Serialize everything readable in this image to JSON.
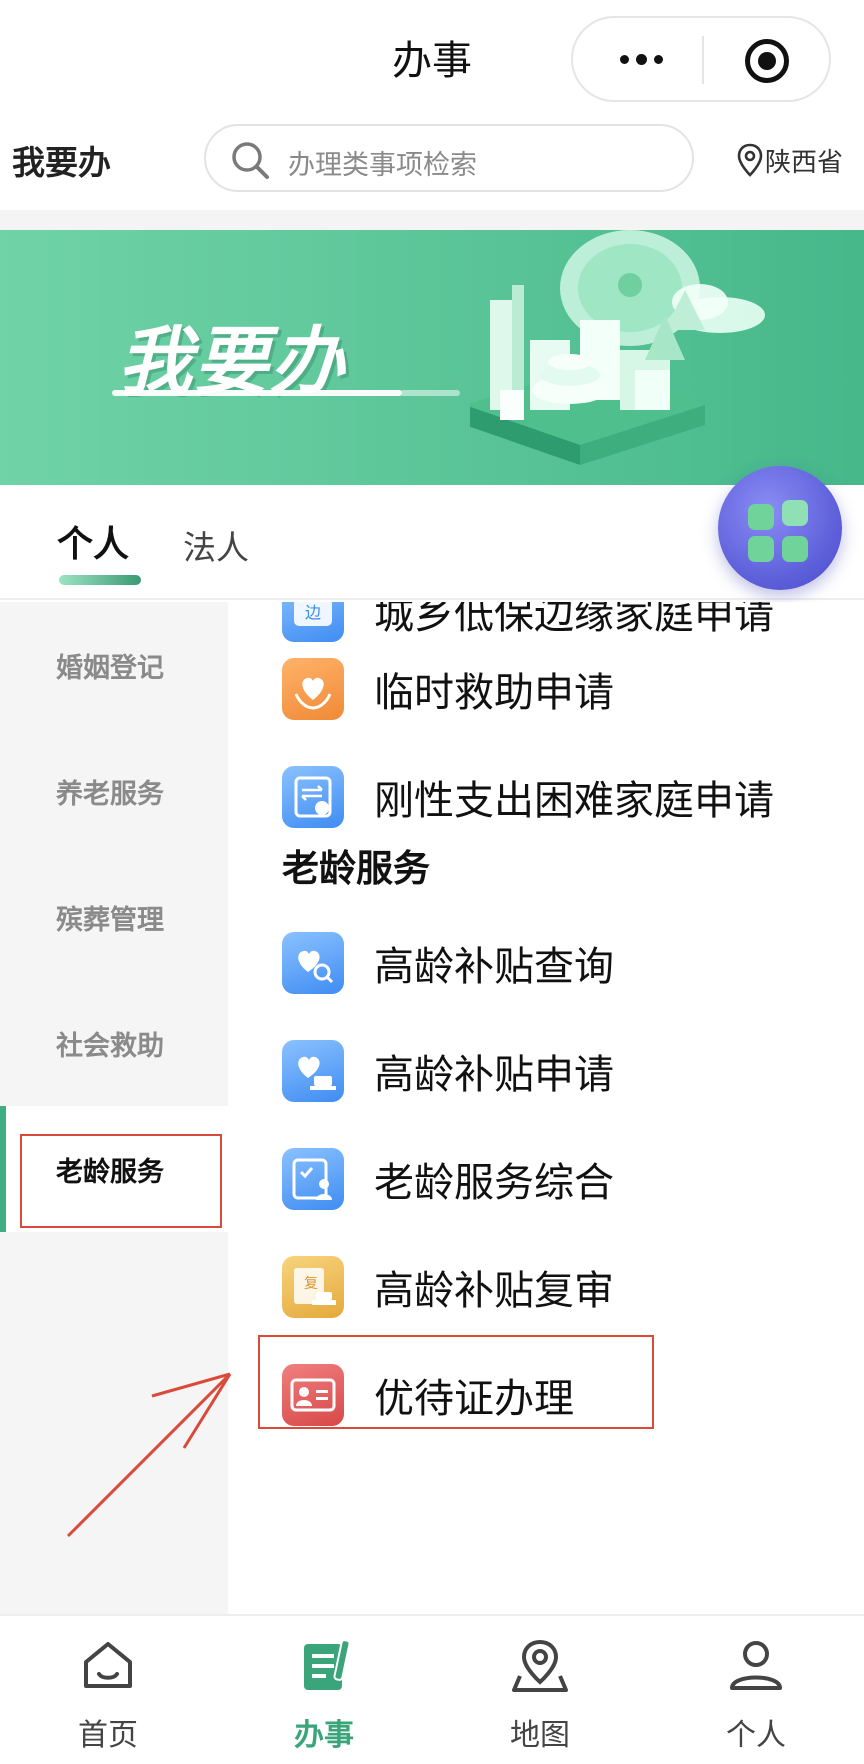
{
  "header": {
    "title": "办事"
  },
  "search_row": {
    "heading": "我要办",
    "search_placeholder": "办理类事项检索",
    "location": "陕西省"
  },
  "banner": {
    "text": "我要办"
  },
  "tabs": [
    {
      "label": "个人",
      "active": true
    },
    {
      "label": "法人",
      "active": false
    }
  ],
  "sidebar": {
    "items": [
      {
        "label": "婚姻登记"
      },
      {
        "label": "养老服务"
      },
      {
        "label": "殡葬管理"
      },
      {
        "label": "社会救助"
      },
      {
        "label": "老龄服务",
        "active": true
      }
    ]
  },
  "content": {
    "partial_item": {
      "label": "城乡低保边缘家庭申请",
      "icon_char": "边"
    },
    "items_top": [
      {
        "label": "临时救助申请",
        "icon": "heart-hands-icon"
      },
      {
        "label": "刚性支出困难家庭申请",
        "icon": "exchange-doc-icon"
      }
    ],
    "section_title": "老龄服务",
    "items": [
      {
        "label": "高龄补贴查询",
        "icon": "heart-search-icon"
      },
      {
        "label": "高龄补贴申请",
        "icon": "heart-stamp-icon"
      },
      {
        "label": "老龄服务综合",
        "icon": "elder-doc-icon"
      },
      {
        "label": "高龄补贴复审",
        "icon": "review-stamp-icon",
        "icon_char": "复"
      },
      {
        "label": "优待证办理",
        "icon": "id-card-icon"
      }
    ]
  },
  "tabbar": {
    "items": [
      {
        "label": "首页",
        "icon": "home-icon"
      },
      {
        "label": "办事",
        "icon": "task-icon",
        "active": true
      },
      {
        "label": "地图",
        "icon": "map-pin-icon"
      },
      {
        "label": "个人",
        "icon": "user-icon"
      }
    ]
  },
  "colors": {
    "accent": "#3aa57a",
    "banner": "#5ec79a",
    "highlight_box": "#d94a3a",
    "fab": "#5a5cd8"
  }
}
